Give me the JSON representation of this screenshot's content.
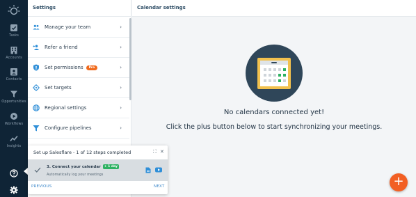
{
  "rail": {
    "items": [
      {
        "label": "Tasks",
        "icon": "tasks-icon"
      },
      {
        "label": "Accounts",
        "icon": "accounts-icon"
      },
      {
        "label": "Contacts",
        "icon": "contacts-icon"
      },
      {
        "label": "Opportunities",
        "icon": "opportunities-icon"
      },
      {
        "label": "Workflows",
        "icon": "workflows-icon"
      },
      {
        "label": "Insights",
        "icon": "insights-icon"
      }
    ],
    "bottom": [
      {
        "icon": "help-icon"
      },
      {
        "icon": "settings-gear-icon"
      }
    ]
  },
  "settings": {
    "title": "Settings",
    "items": [
      {
        "label": "Manage your team",
        "icon": "team-icon"
      },
      {
        "label": "Refer a friend",
        "icon": "refer-friend-icon"
      },
      {
        "label": "Set permissions",
        "icon": "permissions-shield-icon",
        "badge": "Pro"
      },
      {
        "label": "Set targets",
        "icon": "target-icon"
      },
      {
        "label": "Regional settings",
        "icon": "globe-icon"
      },
      {
        "label": "Configure pipelines",
        "icon": "funnel-icon"
      }
    ]
  },
  "main": {
    "title": "Calendar settings",
    "empty_title": "No calendars connected yet!",
    "empty_subtitle": "Click the plus button below to start synchronizing your meetings.",
    "fab_label": "+"
  },
  "onboarding": {
    "title": "Set up Salesflare - 1 of 12 steps completed",
    "step_title": "3. Connect your calendar",
    "step_badge": "+ 1 day",
    "step_subtitle": "Automatically log your meetings",
    "previous_label": "PREVIOUS",
    "next_label": "NEXT",
    "expand_glyph": "⛶",
    "close_glyph": "✕"
  },
  "colors": {
    "rail_bg": "#0f2436",
    "accent_blue": "#2f8fd8",
    "fab_orange": "#f25f23",
    "pro_badge": "#f06a1d",
    "day_badge": "#2eb262"
  }
}
